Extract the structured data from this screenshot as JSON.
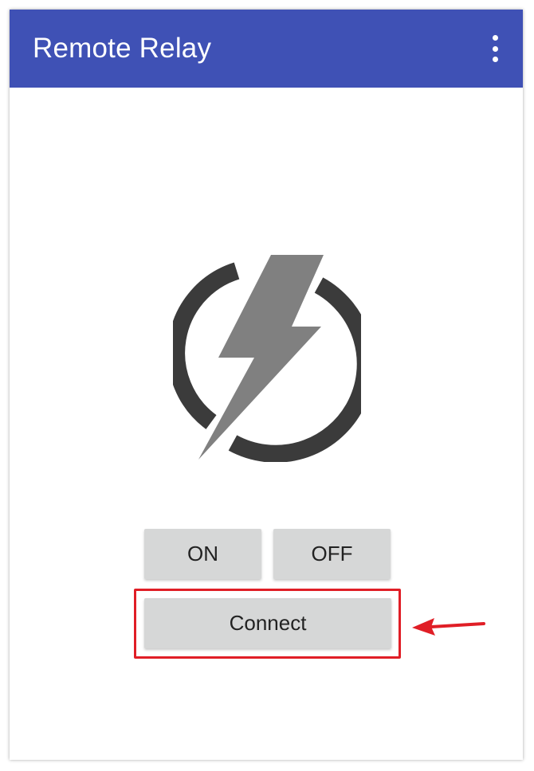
{
  "app": {
    "title": "Remote Relay",
    "header_color": "#3f51b5"
  },
  "header": {
    "menu_icon": "more-vert-icon"
  },
  "logo": {
    "icon": "power-lightning-bolt-icon",
    "ring_color": "#3b3b3b",
    "bolt_color": "#808080"
  },
  "controls": {
    "on_label": "ON",
    "off_label": "OFF",
    "connect_label": "Connect",
    "button_color": "#d6d7d7"
  },
  "annotation": {
    "highlight_color": "#e01e26",
    "arrow_icon": "arrow-left-icon"
  }
}
